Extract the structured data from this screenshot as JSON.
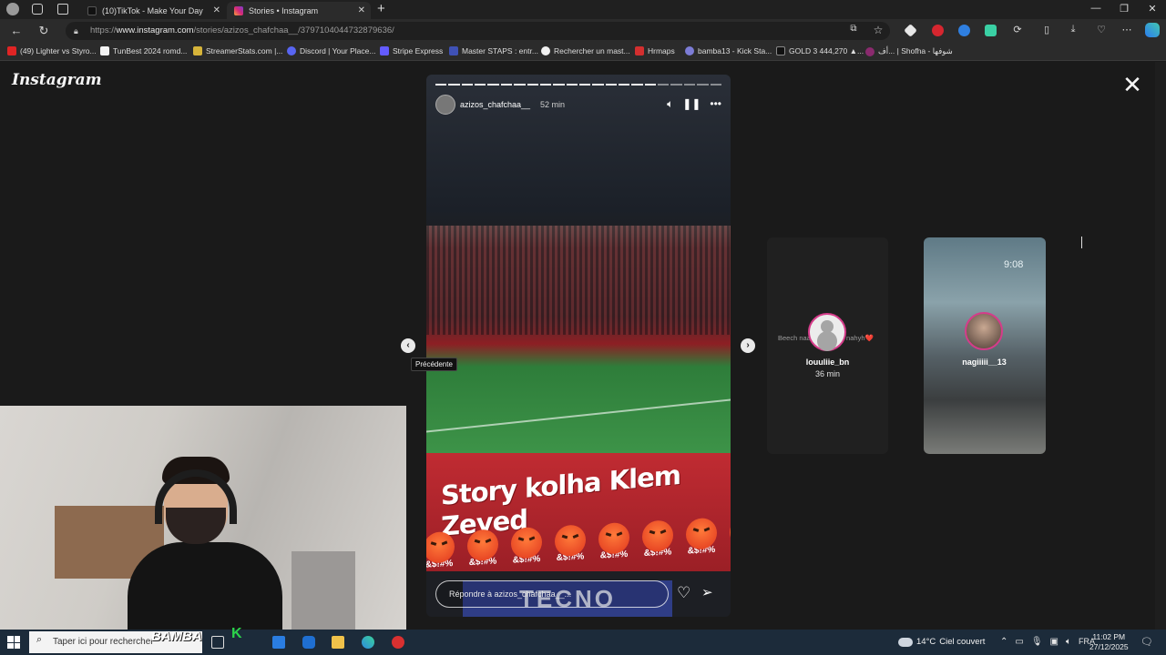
{
  "browser": {
    "tabs": [
      {
        "label": "(10)TikTok - Make Your Day",
        "active": false
      },
      {
        "label": "Stories • Instagram",
        "active": true
      }
    ],
    "url_prefix": "https://",
    "url_host": "www.instagram.com",
    "url_path": "/stories/azizos_chafchaa__/3797104044732879636/",
    "bookmarks": [
      "(49) Lighter vs Styro...",
      "TunBest 2024 romd...",
      "StreamerStats.com |...",
      "Discord | Your Place...",
      "Stripe Express",
      "Master STAPS : entr...",
      "Rechercher un mast...",
      "Hrmaps",
      "bamba13 - Kick Sta...",
      "GOLD 3 444,270 ▲...",
      "أف... | Shofha - شوفها"
    ]
  },
  "instagram": {
    "logo": "Instagram",
    "story": {
      "username": "azizos_chafchaa__",
      "time": "52 min",
      "caption": "Story kolha Klem Zeyed",
      "emoji_text": "&$!#%",
      "reply_placeholder": "Répondre à azizos_chafchaa__...",
      "sponsor_text": "TECNO",
      "progress_segments": 22,
      "progress_done": 17
    },
    "tooltip": "Précédente",
    "previews": [
      {
        "username": "louuliie_bn",
        "time": "36 min",
        "text": "Beech naa                hedha bch nahyh❤️"
      },
      {
        "username": "nagiiiii__13",
        "time": "",
        "clock": "9:08"
      }
    ]
  },
  "overlay": {
    "brand": "BAMBA",
    "brand_letter": "K"
  },
  "taskbar": {
    "search_placeholder": "Taper ici pour rechercher",
    "weather_temp": "14°C",
    "weather_desc": "Ciel couvert",
    "lang": "FRA",
    "time": "11:02 PM",
    "date": "27/12/2025"
  }
}
